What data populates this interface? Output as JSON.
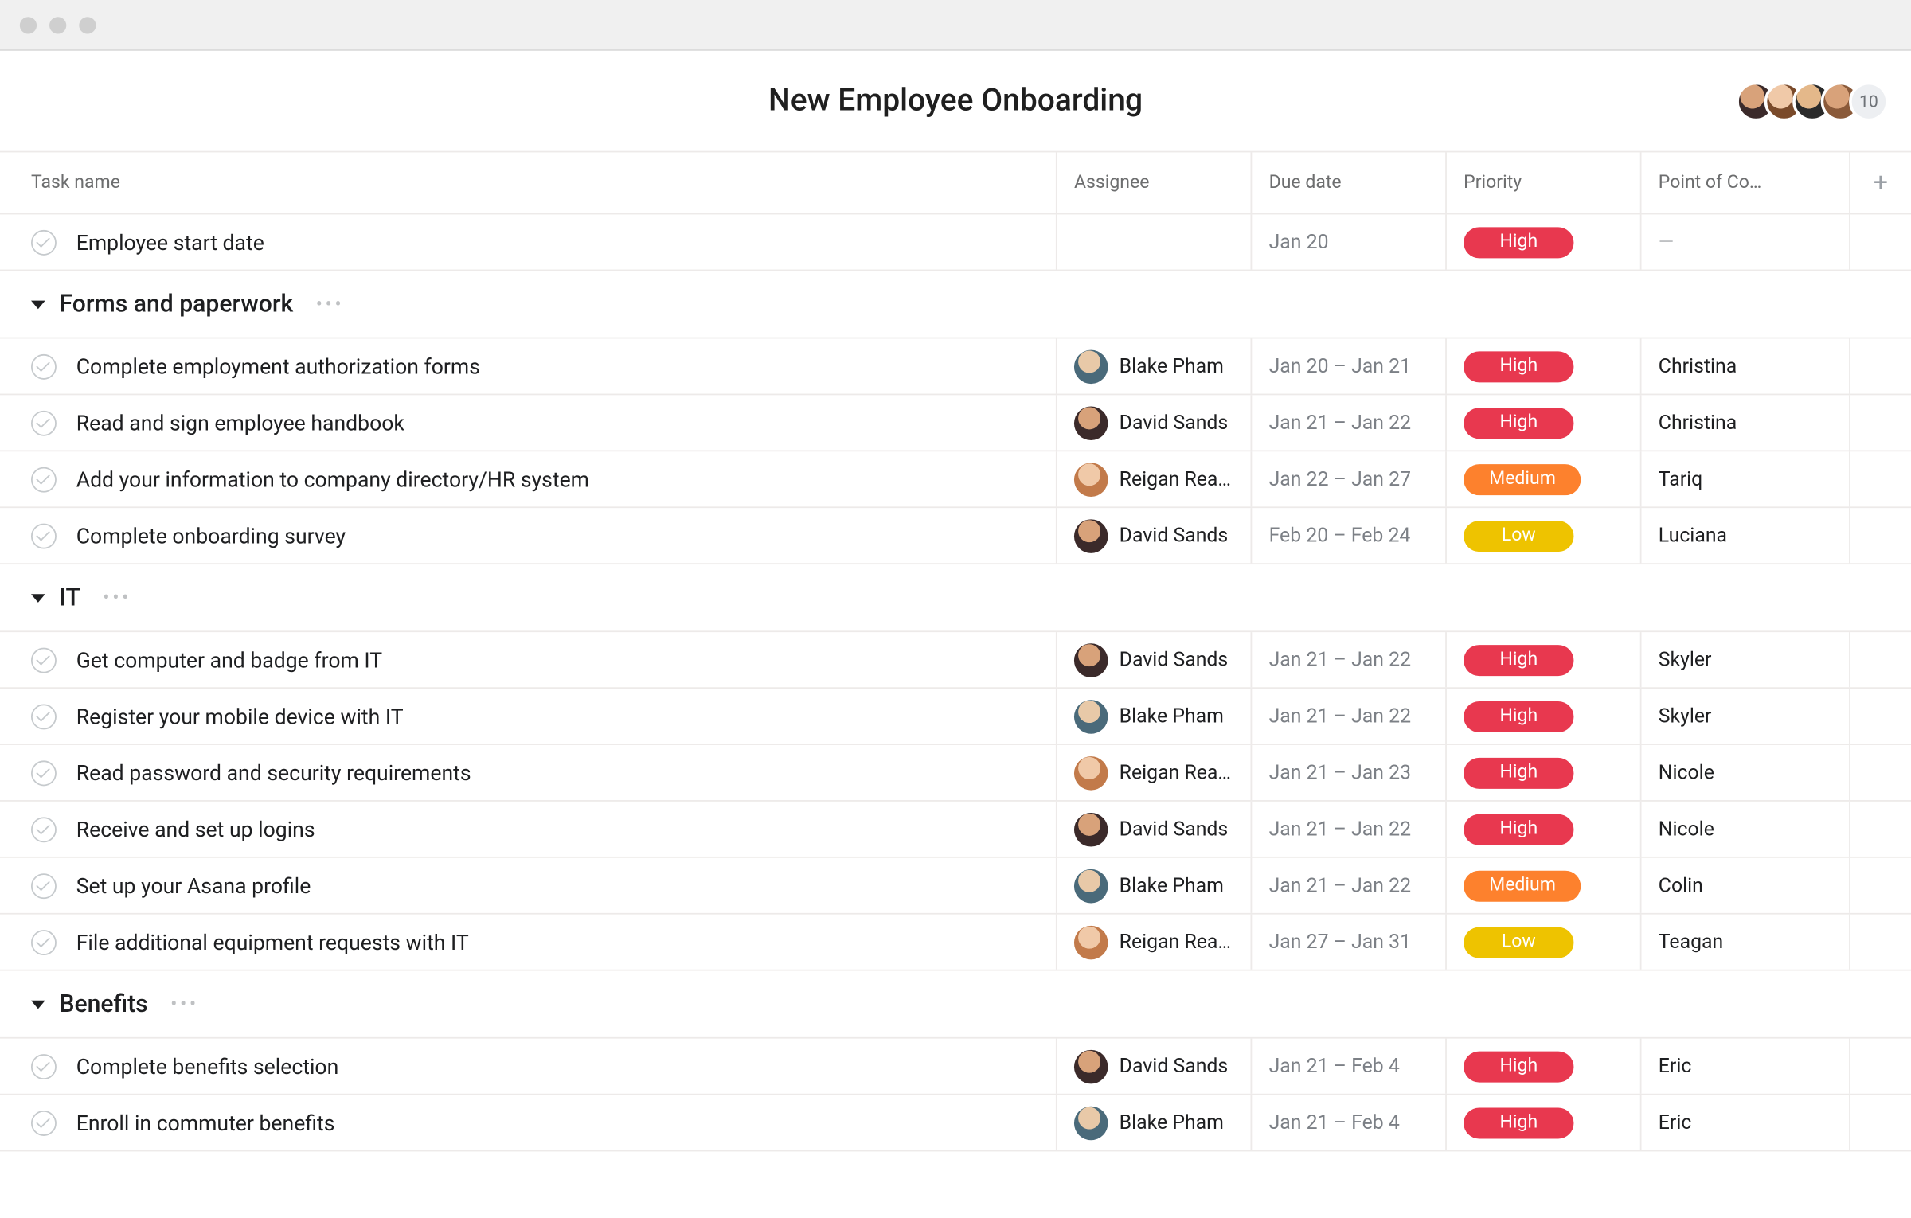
{
  "title": "New Employee Onboarding",
  "member_overflow_count": "10",
  "columns": {
    "task": "Task name",
    "assignee": "Assignee",
    "due": "Due date",
    "priority": "Priority",
    "poc": "Point of Co…",
    "add": "+"
  },
  "priority": {
    "high": "High",
    "medium": "Medium",
    "low": "Low"
  },
  "poc_dash": "—",
  "top_tasks": [
    {
      "name": "Employee start date",
      "assignee": null,
      "avatar": null,
      "due": "Jan 20",
      "priority": "high",
      "poc": null
    }
  ],
  "sections": [
    {
      "name": "Forms and paperwork",
      "tasks": [
        {
          "name": "Complete employment authorization forms",
          "assignee": "Blake Pham",
          "avatar": "blake",
          "due": "Jan 20 – Jan 21",
          "priority": "high",
          "poc": "Christina"
        },
        {
          "name": "Read and sign employee handbook",
          "assignee": "David Sands",
          "avatar": "david",
          "due": "Jan 21 – Jan 22",
          "priority": "high",
          "poc": "Christina"
        },
        {
          "name": "Add your information to company directory/HR system",
          "assignee": "Reigan Rea…",
          "avatar": "reigan",
          "due": "Jan 22 – Jan 27",
          "priority": "medium",
          "poc": "Tariq"
        },
        {
          "name": "Complete onboarding survey",
          "assignee": "David Sands",
          "avatar": "david",
          "due": "Feb 20 – Feb 24",
          "priority": "low",
          "poc": "Luciana"
        }
      ]
    },
    {
      "name": "IT",
      "tasks": [
        {
          "name": "Get computer and badge from IT",
          "assignee": "David Sands",
          "avatar": "david",
          "due": "Jan 21 – Jan 22",
          "priority": "high",
          "poc": "Skyler"
        },
        {
          "name": "Register your mobile device with IT",
          "assignee": "Blake Pham",
          "avatar": "blake",
          "due": "Jan 21 – Jan 22",
          "priority": "high",
          "poc": "Skyler"
        },
        {
          "name": "Read password and security requirements",
          "assignee": "Reigan Rea…",
          "avatar": "reigan",
          "due": "Jan 21 – Jan 23",
          "priority": "high",
          "poc": "Nicole"
        },
        {
          "name": "Receive and set up logins",
          "assignee": "David Sands",
          "avatar": "david",
          "due": "Jan 21 – Jan 22",
          "priority": "high",
          "poc": "Nicole"
        },
        {
          "name": "Set up your Asana profile",
          "assignee": "Blake Pham",
          "avatar": "blake",
          "due": "Jan 21 – Jan 22",
          "priority": "medium",
          "poc": "Colin"
        },
        {
          "name": "File additional equipment requests with IT",
          "assignee": "Reigan Rea…",
          "avatar": "reigan",
          "due": "Jan 27 – Jan 31",
          "priority": "low",
          "poc": "Teagan"
        }
      ]
    },
    {
      "name": "Benefits",
      "tasks": [
        {
          "name": "Complete benefits selection",
          "assignee": "David Sands",
          "avatar": "david",
          "due": "Jan 21 – Feb 4",
          "priority": "high",
          "poc": "Eric"
        },
        {
          "name": "Enroll in commuter benefits",
          "assignee": "Blake Pham",
          "avatar": "blake",
          "due": "Jan 21 – Feb 4",
          "priority": "high",
          "poc": "Eric"
        }
      ]
    }
  ]
}
